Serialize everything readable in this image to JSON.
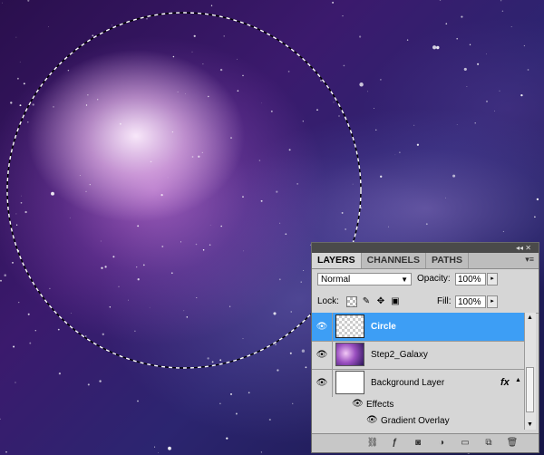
{
  "panel": {
    "tabs": [
      {
        "label": "LAYERS",
        "active": true
      },
      {
        "label": "CHANNELS",
        "active": false
      },
      {
        "label": "PATHS",
        "active": false
      }
    ],
    "blend_mode": "Normal",
    "opacity_label": "Opacity:",
    "opacity_value": "100%",
    "lock_label": "Lock:",
    "fill_label": "Fill:",
    "fill_value": "100%",
    "layers": [
      {
        "name": "Circle",
        "selected": true,
        "thumbnail": "transparent-checker"
      },
      {
        "name": "Step2_Galaxy",
        "selected": false,
        "thumbnail": "galaxy"
      },
      {
        "name": "Background Layer",
        "selected": false,
        "thumbnail": "white",
        "has_effects": true
      }
    ],
    "effects_label": "Effects",
    "effect_items": [
      "Gradient Overlay"
    ],
    "fx_label": "fx"
  },
  "icons": {
    "visibility": "eye-icon",
    "lock_transparent": "checker-lock-icon",
    "lock_image": "brush-icon",
    "lock_position": "move-icon",
    "lock_all": "padlock-icon",
    "bottom": [
      "link-icon",
      "fx-icon",
      "mask-icon",
      "adjustment-icon",
      "folder-icon",
      "new-layer-icon",
      "trash-icon"
    ]
  },
  "colors": {
    "selection_highlight": "#3d9ef5",
    "panel_bg": "#d6d6d6"
  }
}
